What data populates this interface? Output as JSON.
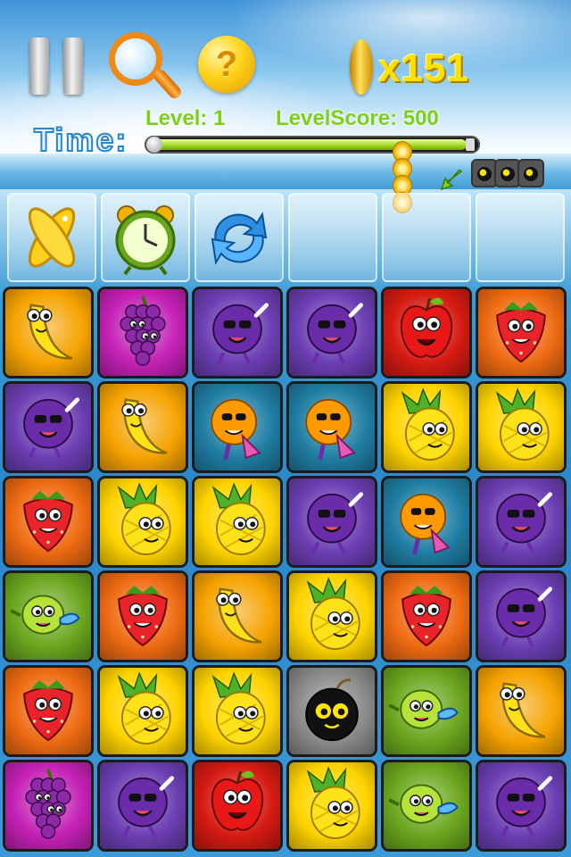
{
  "hud": {
    "coin_count": "x151",
    "level_label": "Level:  1",
    "score_label": "LevelScore: 500",
    "time_label": "Time:",
    "time_fraction": 0.97
  },
  "toolbar": {
    "slots": [
      "gold-ring-powerup",
      "alarm-clock-powerup",
      "shuffle-powerup",
      "empty",
      "empty",
      "empty"
    ]
  },
  "board": {
    "cols": 6,
    "rows": 6,
    "grid": [
      [
        "banana",
        "grape",
        "plum",
        "plum",
        "apple",
        "strawberry"
      ],
      [
        "plum",
        "banana",
        "orange",
        "orange",
        "pineapple",
        "pineapple"
      ],
      [
        "strawberry",
        "pineapple",
        "pineapple",
        "plum",
        "orange",
        "plum"
      ],
      [
        "lime",
        "strawberry",
        "banana",
        "pineapple",
        "strawberry",
        "plum"
      ],
      [
        "strawberry",
        "pineapple",
        "pineapple",
        "bomb",
        "lime",
        "banana"
      ],
      [
        "grape",
        "plum",
        "apple",
        "pineapple",
        "lime",
        "plum"
      ]
    ]
  },
  "tile_colors": {
    "banana": "#f5a300",
    "grape": "#c421b5",
    "plum": "#6b3fb3",
    "apple": "#d51b12",
    "strawberry": "#ee6b12",
    "orange": "#1f7ea3",
    "pineapple": "#ffd400",
    "lime": "#6aa61e",
    "bomb": "#8a8a8a"
  }
}
